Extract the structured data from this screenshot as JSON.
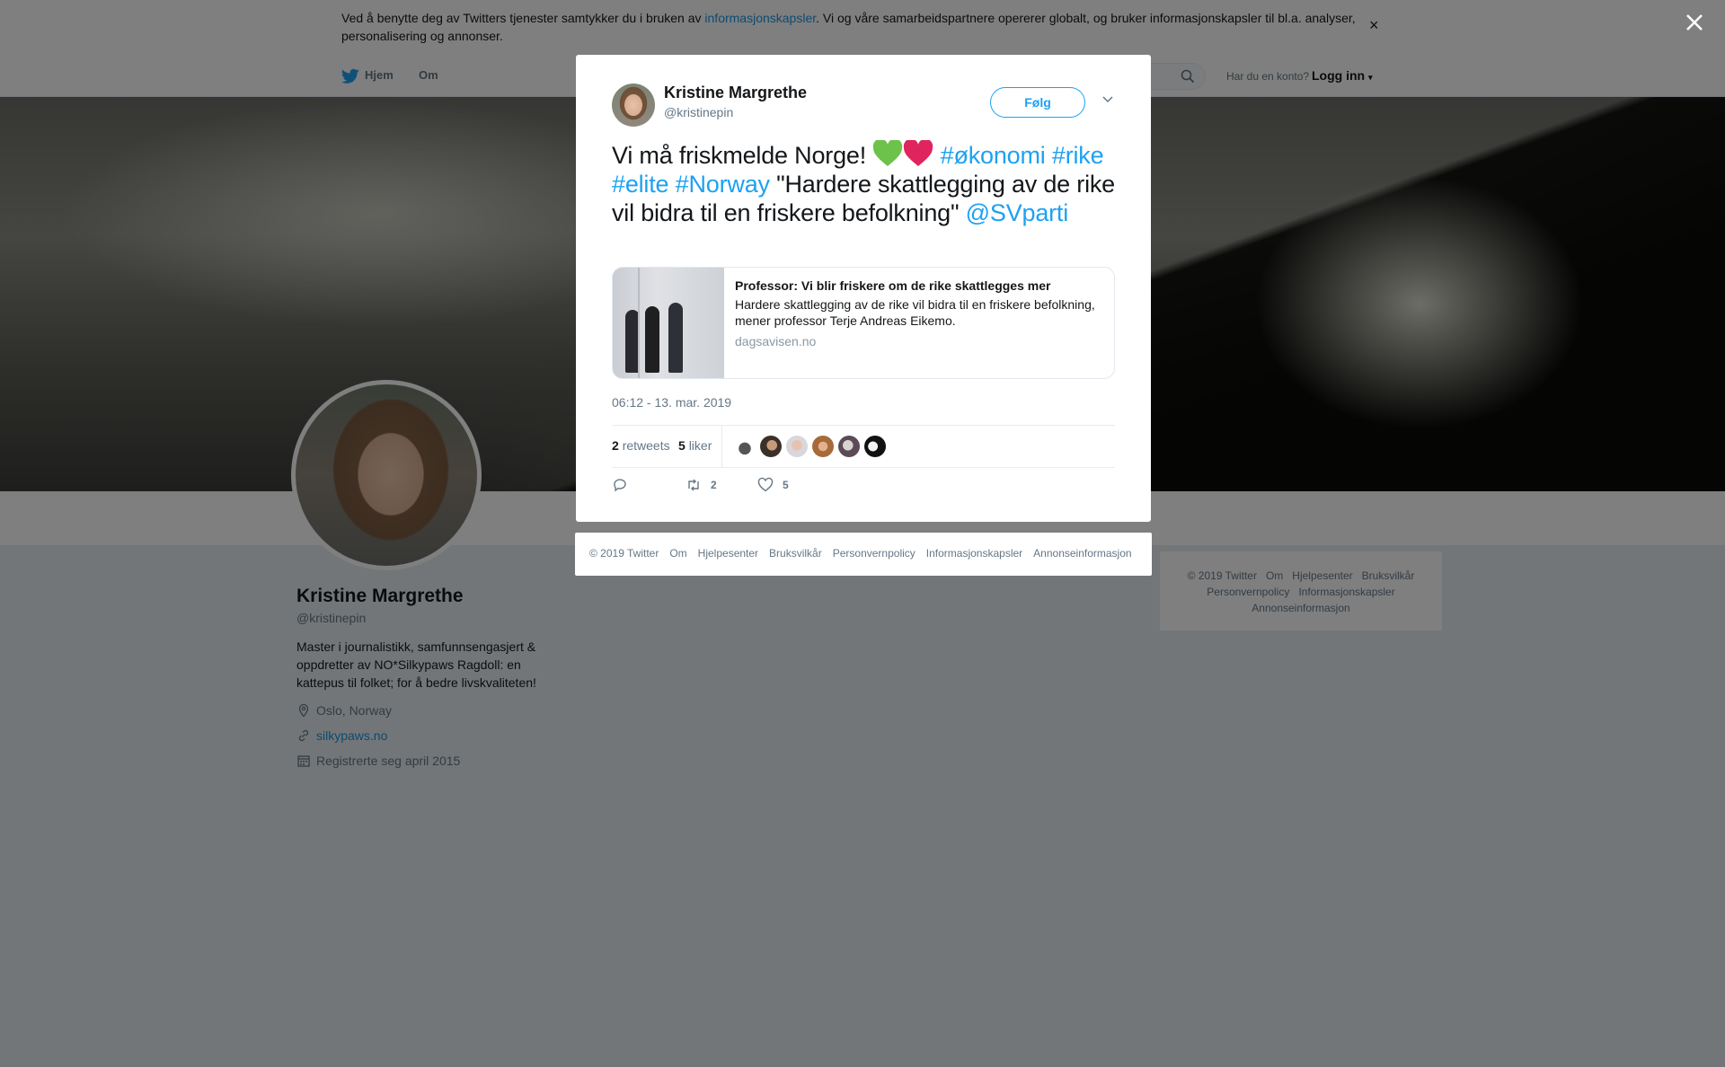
{
  "cookie_bar": {
    "text_before": "Ved å benytte deg av Twitters tjenester samtykker du i bruken av ",
    "link": "informasjonskapsler",
    "text_after": ". Vi og våre samarbeidspartnere opererer globalt, og bruker informasjonskapsler til bl.a. analyser, personalisering og annonser.",
    "close": "×"
  },
  "nav": {
    "home": "Hjem",
    "about": "Om",
    "account_question": "Har du en konto?",
    "login": "Logg inn"
  },
  "profile": {
    "name": "Kristine Margrethe",
    "handle": "@kristinepin",
    "bio": "Master i journalistikk, samfunnsengasjert & oppdretter av NO*Silkypaws Ragdoll: en kattepus til folket; for å bedre livskvaliteten!",
    "location": "Oslo, Norway",
    "website": "silkypaws.no",
    "joined": "Registrerte seg april 2015"
  },
  "sidebar_footer": {
    "line1": [
      "© 2019 Twitter",
      "Om",
      "Hjelpesenter",
      "Bruksvilkår"
    ],
    "line2": [
      "Personvernpolicy",
      "Informasjonskapsler"
    ],
    "line3": [
      "Annonseinformasjon"
    ]
  },
  "tweet": {
    "author_name": "Kristine Margrethe",
    "author_handle": "@kristinepin",
    "follow_label": "Følg",
    "text_start": "Vi må friskmelde Norge! ",
    "tag_okonomi": "#økonomi",
    "tag_rike": "#rike",
    "tag_elite": "#elite",
    "tag_norway": "#Norway",
    "quote": " \"Hardere skattlegging av de rike vil bidra til en friskere befolkning\" ",
    "mention": "@SVparti",
    "card": {
      "title": "Professor: Vi blir friskere om de rike skattlegges mer",
      "description": "Hardere skattlegging av de rike vil bidra til en friskere befolkning, mener professor Terje Andreas Eikemo.",
      "domain": "dagsavisen.no"
    },
    "timestamp": "06:12 - 13. mar. 2019",
    "retweets_count": "2",
    "retweets_label": "retweets",
    "likes_count": "5",
    "likes_label": "liker",
    "action_retweet_count": "2",
    "action_like_count": "5",
    "heart_colors": [
      "#6cc24a",
      "#e0245e"
    ]
  },
  "modal_footer": {
    "links": [
      "© 2019 Twitter",
      "Om",
      "Hjelpesenter",
      "Bruksvilkår",
      "Personvernpolicy",
      "Informasjonskapsler",
      "Annonseinformasjon"
    ]
  },
  "colors": {
    "accent": "#1da1f2",
    "link": "#1b95e0",
    "muted": "#657786"
  }
}
